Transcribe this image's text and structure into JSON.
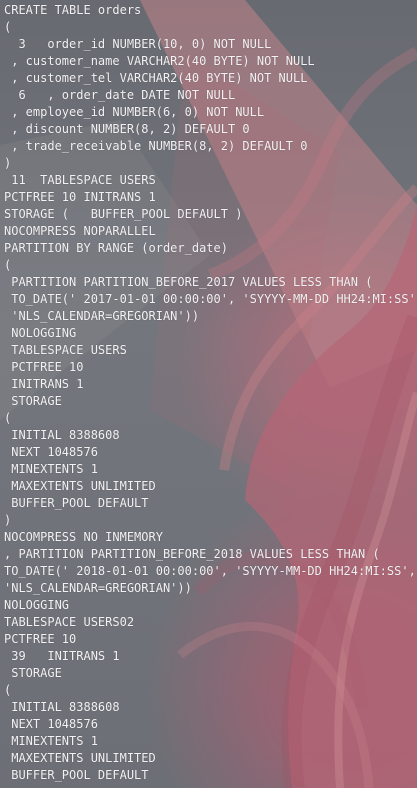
{
  "editor": {
    "lines": [
      "CREATE TABLE orders",
      "(",
      "  3   order_id NUMBER(10, 0) NOT NULL",
      " , customer_name VARCHAR2(40 BYTE) NOT NULL",
      " , customer_tel VARCHAR2(40 BYTE) NOT NULL",
      "  6   , order_date DATE NOT NULL",
      " , employee_id NUMBER(6, 0) NOT NULL",
      " , discount NUMBER(8, 2) DEFAULT 0",
      " , trade_receivable NUMBER(8, 2) DEFAULT 0",
      ")",
      " 11  TABLESPACE USERS",
      "PCTFREE 10 INITRANS 1",
      "STORAGE (   BUFFER_POOL DEFAULT )",
      "NOCOMPRESS NOPARALLEL",
      "PARTITION BY RANGE (order_date)",
      "(",
      " PARTITION PARTITION_BEFORE_2017 VALUES LESS THAN (",
      " TO_DATE(' 2017-01-01 00:00:00', 'SYYYY-MM-DD HH24:MI:SS',",
      " 'NLS_CALENDAR=GREGORIAN'))",
      " NOLOGGING",
      " TABLESPACE USERS",
      " PCTFREE 10",
      " INITRANS 1",
      " STORAGE",
      "(",
      " INITIAL 8388608",
      " NEXT 1048576",
      " MINEXTENTS 1",
      " MAXEXTENTS UNLIMITED",
      " BUFFER_POOL DEFAULT",
      ")",
      "NOCOMPRESS NO INMEMORY",
      ", PARTITION PARTITION_BEFORE_2018 VALUES LESS THAN (",
      "TO_DATE(' 2018-01-01 00:00:00', 'SYYYY-MM-DD HH24:MI:SS',",
      "'NLS_CALENDAR=GREGORIAN'))",
      "NOLOGGING",
      "TABLESPACE USERS02",
      "PCTFREE 10",
      " 39   INITRANS 1",
      " STORAGE",
      "(",
      " INITIAL 8388608",
      " NEXT 1048576",
      " MINEXTENTS 1",
      " MAXEXTENTS UNLIMITED",
      " BUFFER_POOL DEFAULT"
    ]
  },
  "colors": {
    "text": "#f3f1f3",
    "background": "#747780",
    "accent": "#c96b7f"
  }
}
